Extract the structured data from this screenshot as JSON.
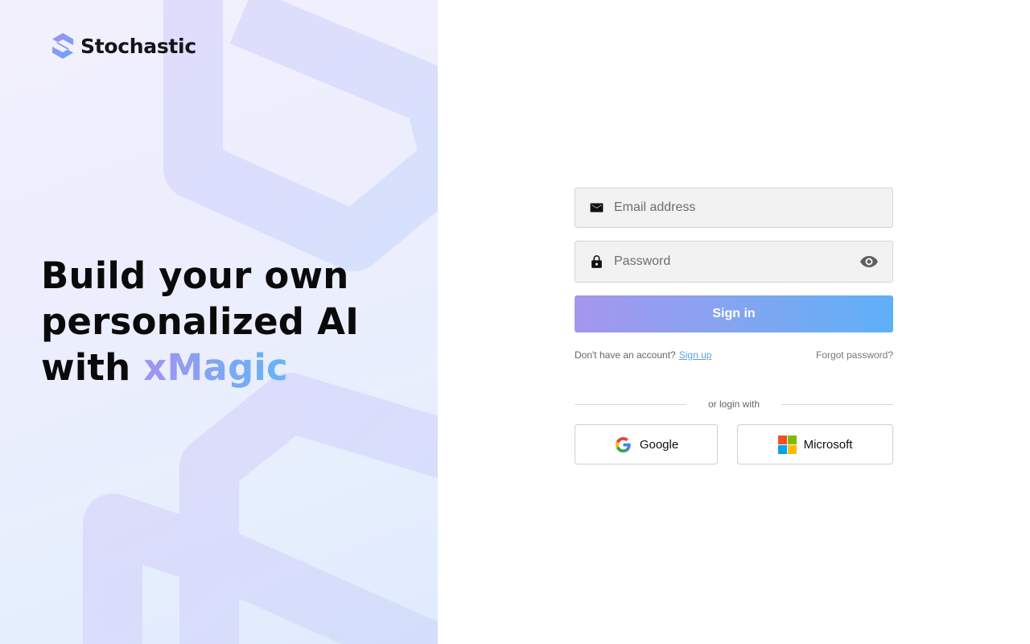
{
  "brand": {
    "name": "Stochastic",
    "logo_icon": "stochastic-logo-icon"
  },
  "headline": {
    "line1": "Build your own",
    "line2": "personalized AI",
    "line3_prefix": "with ",
    "line3_accent": "xMagic"
  },
  "form": {
    "email": {
      "placeholder": "Email address",
      "value": "",
      "icon": "envelope-icon"
    },
    "password": {
      "placeholder": "Password",
      "value": "",
      "icon": "lock-icon",
      "toggle_icon": "eye-icon"
    },
    "signin_label": "Sign in",
    "no_account_text": "Don't have an account?",
    "signup_label": "Sign up",
    "forgot_label": "Forgot password?",
    "divider_text": "or login with",
    "social": [
      {
        "label": "Google",
        "icon": "google-icon"
      },
      {
        "label": "Microsoft",
        "icon": "microsoft-icon"
      }
    ]
  },
  "colors": {
    "accent_start": "#a596ef",
    "accent_end": "#5eb0f8",
    "link": "#5aa2e6",
    "field_bg": "#f2f2f2"
  }
}
